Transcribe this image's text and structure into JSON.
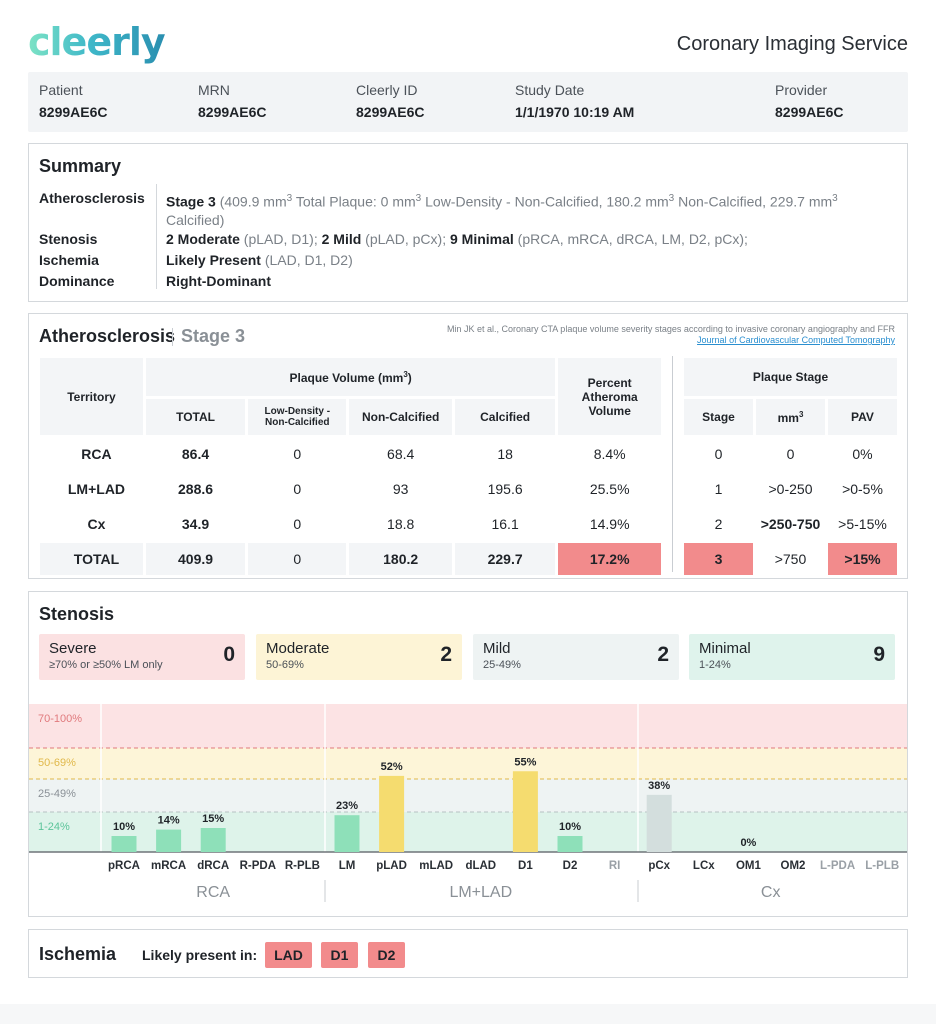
{
  "header": {
    "logo": "cleerly",
    "service": "Coronary Imaging Service"
  },
  "patient_bar": [
    {
      "label": "Patient",
      "value": "8299AE6C"
    },
    {
      "label": "MRN",
      "value": "8299AE6C"
    },
    {
      "label": "Cleerly ID",
      "value": "8299AE6C"
    },
    {
      "label": "Study Date",
      "value": "1/1/1970 10:19 AM"
    },
    {
      "label": "Provider",
      "value": "8299AE6C"
    }
  ],
  "summary": {
    "title": "Summary",
    "atherosclerosis_label": "Atherosclerosis",
    "atherosclerosis_stage": "Stage 3",
    "atherosclerosis_detail_a": " (409.9 mm",
    "atherosclerosis_detail_b": " Total Plaque: 0 mm",
    "atherosclerosis_detail_c": " Low-Density - Non-Calcified, 180.2 mm",
    "atherosclerosis_detail_d": " Non-Calcified, 229.7 mm",
    "atherosclerosis_detail_e": " Calcified)",
    "sup": "3",
    "stenosis_label": "Stenosis",
    "stenosis_moderate": "2 Moderate",
    "stenosis_moderate_list": " (pLAD, D1); ",
    "stenosis_mild": "2 Mild",
    "stenosis_mild_list": " (pLAD, pCx); ",
    "stenosis_minimal": "9 Minimal",
    "stenosis_minimal_list": " (pRCA, mRCA, dRCA, LM, D2, pCx);",
    "ischemia_label": "Ischemia",
    "ischemia_value": "Likely Present",
    "ischemia_list": " (LAD, D1, D2)",
    "dominance_label": "Dominance",
    "dominance_value": "Right-Dominant"
  },
  "atherosclerosis": {
    "title": "Atherosclerosis",
    "stage": "Stage 3",
    "citation": "Min JK et al., Coronary CTA plaque volume severity stages according to invasive coronary angiography and FFR",
    "citation_link": "Journal of Cardiovascular Computed Tomography",
    "headers": {
      "territory": "Territory",
      "plaque_volume": "Plaque Volume (mm",
      "plaque_volume_end": ")",
      "total": "TOTAL",
      "low_density_a": "Low-Density -",
      "low_density_b": "Non-Calcified",
      "non_calcified": "Non-Calcified",
      "calcified": "Calcified",
      "pav_a": "Percent",
      "pav_b": "Atheroma",
      "pav_c": "Volume",
      "plaque_stage": "Plaque Stage",
      "stage": "Stage",
      "mm": "mm",
      "pav": "PAV"
    },
    "rows": [
      {
        "territory": "RCA",
        "total": "86.4",
        "low_density": "0",
        "non_calcified": "68.4",
        "calcified": "18",
        "pav": "8.4%",
        "stage": "0",
        "mm": "0",
        "pav_range": "0%"
      },
      {
        "territory": "LM+LAD",
        "total": "288.6",
        "low_density": "0",
        "non_calcified": "93",
        "calcified": "195.6",
        "pav": "25.5%",
        "stage": "1",
        "mm": ">0-250",
        "pav_range": ">0-5%"
      },
      {
        "territory": "Cx",
        "total": "34.9",
        "low_density": "0",
        "non_calcified": "18.8",
        "calcified": "16.1",
        "pav": "14.9%",
        "stage": "2",
        "mm": ">250-750",
        "pav_range": ">5-15%"
      },
      {
        "territory": "TOTAL",
        "total": "409.9",
        "low_density": "0",
        "non_calcified": "180.2",
        "calcified": "229.7",
        "pav": "17.2%",
        "stage": "3",
        "mm": ">750",
        "pav_range": ">15%"
      }
    ]
  },
  "stenosis": {
    "title": "Stenosis",
    "boxes": [
      {
        "name": "Severe",
        "range": "≥70% or ≥50% LM only",
        "count": "0",
        "color": "#fbe1e2"
      },
      {
        "name": "Moderate",
        "range": "50-69%",
        "count": "2",
        "color": "#fdf4d6"
      },
      {
        "name": "Mild",
        "range": "25-49%",
        "count": "2",
        "color": "#eef3f3"
      },
      {
        "name": "Minimal",
        "range": "1-24%",
        "count": "9",
        "color": "#dff3ec"
      }
    ],
    "bands": [
      {
        "label": "70-100%",
        "from": 70,
        "to": 100,
        "color": "#fce3e4",
        "text_color": "#e07a7d"
      },
      {
        "label": "50-69%",
        "from": 50,
        "to": 70,
        "color": "#fdf5d8",
        "text_color": "#e0b84a"
      },
      {
        "label": "25-49%",
        "from": 25,
        "to": 50,
        "color": "#eef3f3",
        "text_color": "#8a9096"
      },
      {
        "label": "1-24%",
        "from": 0,
        "to": 25,
        "color": "#def3ea",
        "text_color": "#5cc49a"
      }
    ],
    "chart_data": {
      "type": "bar",
      "categories": [
        "pRCA",
        "mRCA",
        "dRCA",
        "R-PDA",
        "R-PLB",
        "LM",
        "pLAD",
        "mLAD",
        "dLAD",
        "D1",
        "D2",
        "RI",
        "pCx",
        "LCx",
        "OM1",
        "OM2",
        "L-PDA",
        "L-PLB"
      ],
      "values": [
        10,
        14,
        15,
        null,
        null,
        23,
        52,
        null,
        null,
        55,
        10,
        null,
        38,
        null,
        0,
        null,
        null,
        null
      ],
      "value_labels": [
        "10%",
        "14%",
        "15%",
        "",
        "",
        "23%",
        "52%",
        "",
        "",
        "55%",
        "10%",
        "",
        "38%",
        "",
        "0%",
        "",
        "",
        ""
      ],
      "greyed": [
        "RI",
        "L-PDA",
        "L-PLB"
      ],
      "groups": [
        {
          "name": "RCA",
          "start": 0,
          "end": 4
        },
        {
          "name": "LM+LAD",
          "start": 5,
          "end": 11
        },
        {
          "name": "Cx",
          "start": 12,
          "end": 17
        }
      ],
      "ylim": [
        0,
        100
      ],
      "colors": {
        "minimal": "#8ee0b9",
        "moderate": "#f5dc6f",
        "mild": "#d3dedd",
        "grey_label": "#9aa0a6"
      }
    }
  },
  "ischemia": {
    "title": "Ischemia",
    "text": "Likely present in:",
    "tags": [
      "LAD",
      "D1",
      "D2"
    ]
  }
}
